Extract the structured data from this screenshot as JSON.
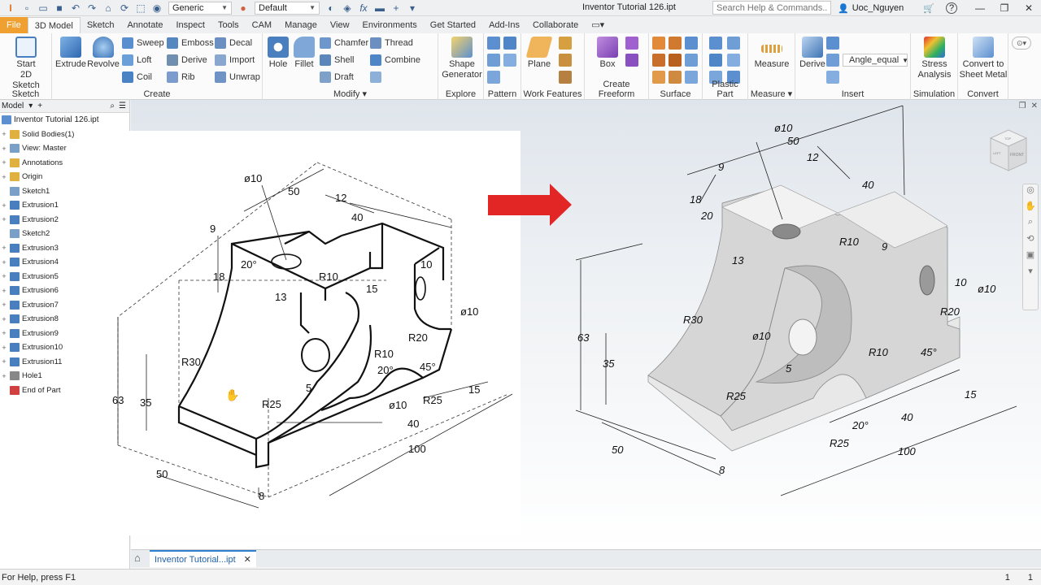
{
  "titlebar": {
    "material": "Generic",
    "appearance": "Default",
    "doc_title": "Inventor Tutorial 126.ipt",
    "search_placeholder": "Search Help & Commands...",
    "user": "Uoc_Nguyen",
    "help": "?"
  },
  "tabs": [
    "File",
    "3D Model",
    "Sketch",
    "Annotate",
    "Inspect",
    "Tools",
    "CAM",
    "Manage",
    "View",
    "Environments",
    "Get Started",
    "Add-Ins",
    "Collaborate"
  ],
  "active_tab": "3D Model",
  "ribbon": {
    "sketch": {
      "label": "Sketch",
      "start": "Start",
      "start2": "2D Sketch"
    },
    "create": {
      "label": "Create",
      "extrude": "Extrude",
      "revolve": "Revolve",
      "sweep": "Sweep",
      "loft": "Loft",
      "coil": "Coil",
      "emboss": "Emboss",
      "derive": "Derive",
      "rib": "Rib",
      "decal": "Decal",
      "import": "Import",
      "unwrap": "Unwrap"
    },
    "modify": {
      "label": "Modify",
      "hole": "Hole",
      "fillet": "Fillet",
      "chamfer": "Chamfer",
      "shell": "Shell",
      "draft": "Draft",
      "thread": "Thread",
      "combine": "Combine"
    },
    "explore": {
      "label": "Explore",
      "shape": "Shape",
      "generator": "Generator"
    },
    "pattern": {
      "label": "Pattern"
    },
    "work_features": {
      "label": "Work Features",
      "plane": "Plane"
    },
    "freeform": {
      "label": "Create Freeform",
      "box": "Box"
    },
    "surface": {
      "label": "Surface"
    },
    "plastic": {
      "label": "Plastic Part"
    },
    "measure": {
      "label": "Measure",
      "btn": "Measure"
    },
    "insert": {
      "label": "Insert",
      "derive": "Derive",
      "angle": "Angle_equal"
    },
    "simulation": {
      "label": "Simulation",
      "btn1": "Stress",
      "btn2": "Analysis"
    },
    "convert": {
      "label": "Convert",
      "btn1": "Convert to",
      "btn2": "Sheet Metal"
    }
  },
  "browser": {
    "tab": "Model",
    "root": "Inventor Tutorial 126.ipt",
    "items": [
      {
        "label": "Solid Bodies(1)",
        "plus": true,
        "color": "#e0b040"
      },
      {
        "label": "View: Master",
        "plus": true,
        "color": "#7aa0c8"
      },
      {
        "label": "Annotations",
        "plus": true,
        "color": "#e0b040"
      },
      {
        "label": "Origin",
        "plus": true,
        "color": "#e0b040"
      },
      {
        "label": "Sketch1",
        "plus": false,
        "color": "#7aa0c8"
      },
      {
        "label": "Extrusion1",
        "plus": true,
        "color": "#4a7fbf"
      },
      {
        "label": "Extrusion2",
        "plus": true,
        "color": "#4a7fbf"
      },
      {
        "label": "Sketch2",
        "plus": false,
        "color": "#7aa0c8"
      },
      {
        "label": "Extrusion3",
        "plus": true,
        "color": "#4a7fbf"
      },
      {
        "label": "Extrusion4",
        "plus": true,
        "color": "#4a7fbf"
      },
      {
        "label": "Extrusion5",
        "plus": true,
        "color": "#4a7fbf"
      },
      {
        "label": "Extrusion6",
        "plus": true,
        "color": "#4a7fbf"
      },
      {
        "label": "Extrusion7",
        "plus": true,
        "color": "#4a7fbf"
      },
      {
        "label": "Extrusion8",
        "plus": true,
        "color": "#4a7fbf"
      },
      {
        "label": "Extrusion9",
        "plus": true,
        "color": "#4a7fbf"
      },
      {
        "label": "Extrusion10",
        "plus": true,
        "color": "#4a7fbf"
      },
      {
        "label": "Extrusion11",
        "plus": true,
        "color": "#4a7fbf"
      },
      {
        "label": "Hole1",
        "plus": true,
        "color": "#888888"
      },
      {
        "label": "End of Part",
        "plus": false,
        "color": "#d04040"
      }
    ]
  },
  "drawing_dims": [
    "ø10",
    "50",
    "12",
    "40",
    "9",
    "18",
    "20°",
    "R10",
    "15",
    "10",
    "ø10",
    "13",
    "R20",
    "R30",
    "R10",
    "45°",
    "20°",
    "63",
    "35",
    "R25",
    "5",
    "ø10",
    "R25",
    "15",
    "40",
    "100",
    "50",
    "8"
  ],
  "model_dims": [
    "ø10",
    "50",
    "12",
    "40",
    "9",
    "18",
    "20",
    "13",
    "R10",
    "9",
    "ø10",
    "10",
    "R20",
    "R30",
    "ø10",
    "63",
    "35",
    "5",
    "R10",
    "45°",
    "R25",
    "20°",
    "R25",
    "15",
    "40",
    "100",
    "50",
    "8"
  ],
  "viewcube": {
    "top": "TOP",
    "left": "LEFT",
    "front": "FRONT"
  },
  "doc_tab": "Inventor Tutorial...ipt",
  "status": {
    "help": "For Help, press F1",
    "n1": "1",
    "n2": "1"
  }
}
